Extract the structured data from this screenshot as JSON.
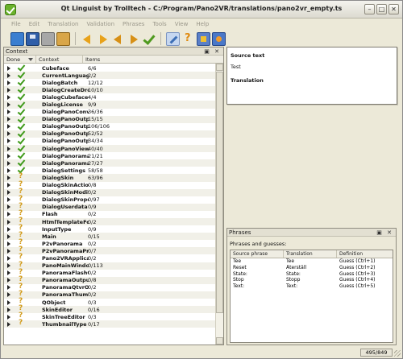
{
  "window": {
    "title": "Qt Linguist by Trolltech - C:/Program/Pano2VR/translations/pano2vr_empty.ts"
  },
  "menu": [
    "File",
    "Edit",
    "Translation",
    "Validation",
    "Phrases",
    "Tools",
    "View",
    "Help"
  ],
  "toolbar": {
    "icons": [
      "open-icon",
      "save-icon",
      "print-icon",
      "phrasebook-icon",
      "prev-unfinished-icon",
      "next-unfinished-icon",
      "prev-icon",
      "next-icon",
      "done-next-icon",
      "edit-icon",
      "whats-this-icon",
      "phrase-validation-icon",
      "accelerator-validation-icon"
    ]
  },
  "context": {
    "title": "Context",
    "columns": {
      "done": "Done",
      "context": "Context",
      "items": "Items"
    },
    "rows": [
      {
        "name": "Cubeface",
        "items": "6/6",
        "done": true
      },
      {
        "name": "CurrentLanguage",
        "items": "2/2",
        "done": true
      },
      {
        "name": "DialogBatch",
        "items": "12/12",
        "done": true
      },
      {
        "name": "DialogCreateDro...",
        "items": "10/10",
        "done": true
      },
      {
        "name": "DialogCubefaceQ...",
        "items": "4/4",
        "done": true
      },
      {
        "name": "DialogLicense",
        "items": "9/9",
        "done": true
      },
      {
        "name": "DialogPanoConve...",
        "items": "36/36",
        "done": true
      },
      {
        "name": "DialogPanoOutpu...",
        "items": "15/15",
        "done": true
      },
      {
        "name": "DialogPanoOutpu...",
        "items": "106/106",
        "done": true
      },
      {
        "name": "DialogPanoOutpu...",
        "items": "52/52",
        "done": true
      },
      {
        "name": "DialogPanoOutpu...",
        "items": "34/34",
        "done": true
      },
      {
        "name": "DialogPanoViewer",
        "items": "40/40",
        "done": true
      },
      {
        "name": "DialogPanoramaI...",
        "items": "21/21",
        "done": true
      },
      {
        "name": "DialogPanoramaI...",
        "items": "27/27",
        "done": true
      },
      {
        "name": "DialogSettings",
        "items": "58/58",
        "done": true
      },
      {
        "name": "DialogSkin",
        "items": "63/96",
        "done": false
      },
      {
        "name": "DialogSkinAction",
        "items": "0/8",
        "done": false
      },
      {
        "name": "DialogSkinModifie...",
        "items": "0/2",
        "done": false
      },
      {
        "name": "DialogSkinProper...",
        "items": "0/97",
        "done": false
      },
      {
        "name": "DialogUserdata",
        "items": "0/9",
        "done": false
      },
      {
        "name": "Flash",
        "items": "0/2",
        "done": false
      },
      {
        "name": "HtmlTemplateFor...",
        "items": "0/2",
        "done": false
      },
      {
        "name": "InputType",
        "items": "0/9",
        "done": false
      },
      {
        "name": "Main",
        "items": "0/15",
        "done": false
      },
      {
        "name": "P2vPanorama",
        "items": "0/2",
        "done": false
      },
      {
        "name": "P2vPanoramaPro...",
        "items": "0/7",
        "done": false
      },
      {
        "name": "Pano2VRApplicati...",
        "items": "0/2",
        "done": false
      },
      {
        "name": "PanoMainWindow",
        "items": "0/113",
        "done": false
      },
      {
        "name": "PanoramaFlashO...",
        "items": "0/2",
        "done": false
      },
      {
        "name": "PanoramaOutput",
        "items": "0/8",
        "done": false
      },
      {
        "name": "PanoramaQtvrOu...",
        "items": "0/2",
        "done": false
      },
      {
        "name": "PanoramaThumb...",
        "items": "0/2",
        "done": false
      },
      {
        "name": "QObject",
        "items": "0/3",
        "done": false
      },
      {
        "name": "SkinEditor",
        "items": "0/16",
        "done": false
      },
      {
        "name": "SkinTreeEditor",
        "items": "0/3",
        "done": false
      },
      {
        "name": "ThumbnailType",
        "items": "0/17",
        "done": false
      }
    ]
  },
  "source": {
    "source_label": "Source text",
    "source_value": "Test",
    "translation_label": "Translation"
  },
  "phrases": {
    "title": "Phrases",
    "caption": "Phrases and guesses:",
    "columns": {
      "source": "Source phrase",
      "translation": "Translation",
      "definition": "Definition"
    },
    "rows": [
      {
        "source": "Tee",
        "translation": "Tee",
        "definition": "Guess (Ctrl+1)"
      },
      {
        "source": "Reset",
        "translation": "Återställ",
        "definition": "Guess (Ctrl+2)"
      },
      {
        "source": "State:",
        "translation": "State:",
        "definition": "Guess (Ctrl+3)"
      },
      {
        "source": "Stop",
        "translation": "Stopp",
        "definition": "Guess (Ctrl+4)"
      },
      {
        "source": "Text:",
        "translation": "Text:",
        "definition": "Guess (Ctrl+5)"
      }
    ]
  },
  "status": {
    "count": "495/849"
  },
  "pane_controls": {
    "float": "▣",
    "close": "✕"
  }
}
